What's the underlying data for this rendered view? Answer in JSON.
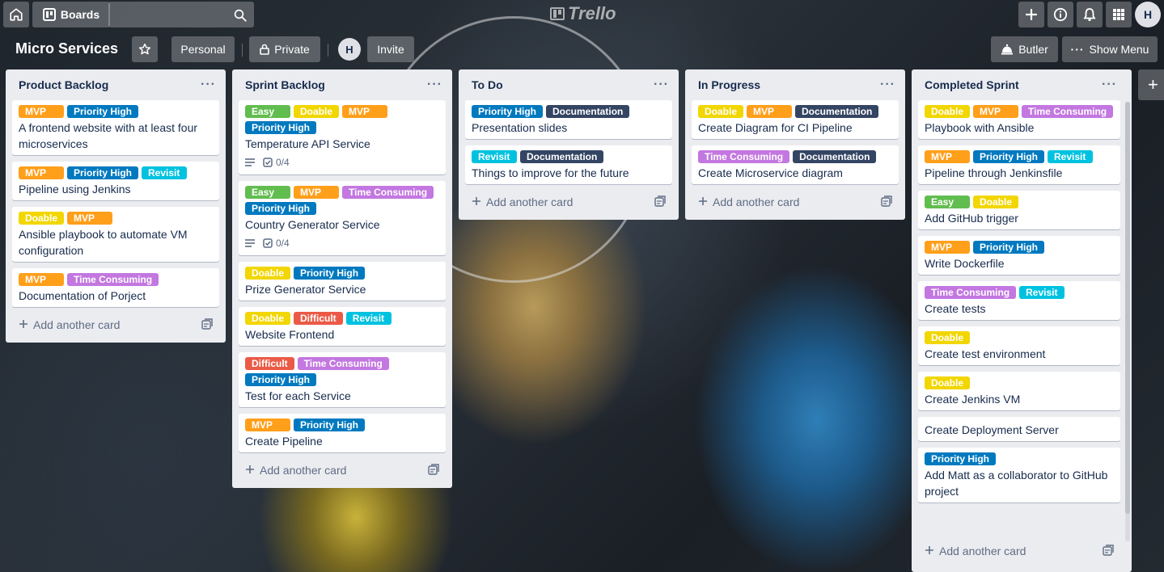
{
  "topbar": {
    "boards_label": "Boards",
    "logo_text": "Trello",
    "avatar_initial": "H"
  },
  "board": {
    "title": "Micro Services",
    "personal_label": "Personal",
    "private_label": "Private",
    "member_initial": "H",
    "invite_label": "Invite",
    "butler_label": "Butler",
    "show_menu_label": "Show Menu"
  },
  "label_colors": {
    "MVP": "#ff9f1a",
    "Priority High": "#0079bf",
    "Revisit": "#00c2e0",
    "Doable": "#f2d600",
    "Time Consuming": "#c377e0",
    "Easy": "#61bd4f",
    "Documentation": "#344563",
    "Difficult": "#eb5a46"
  },
  "add_card_label": "Add another card",
  "lists": [
    {
      "title": "Product Backlog",
      "cards": [
        {
          "labels": [
            "MVP",
            "Priority High"
          ],
          "title": "A frontend website with at least four microservices"
        },
        {
          "labels": [
            "MVP",
            "Priority High",
            "Revisit"
          ],
          "title": "Pipeline using Jenkins"
        },
        {
          "labels": [
            "Doable",
            "MVP"
          ],
          "title": "Ansible playbook to automate VM configuration"
        },
        {
          "labels": [
            "MVP",
            "Time Consuming"
          ],
          "title": "Documentation of Porject"
        }
      ]
    },
    {
      "title": "Sprint Backlog",
      "cards": [
        {
          "labels": [
            "Easy",
            "Doable",
            "MVP",
            "Priority High"
          ],
          "title": "Temperature API Service",
          "checklist": "0/4"
        },
        {
          "labels": [
            "Easy",
            "MVP",
            "Time Consuming",
            "Priority High"
          ],
          "title": "Country Generator Service",
          "checklist": "0/4"
        },
        {
          "labels": [
            "Doable",
            "Priority High"
          ],
          "title": "Prize Generator Service"
        },
        {
          "labels": [
            "Doable",
            "Difficult",
            "Revisit"
          ],
          "title": "Website Frontend"
        },
        {
          "labels": [
            "Difficult",
            "Time Consuming",
            "Priority High"
          ],
          "title": "Test for each Service"
        },
        {
          "labels": [
            "MVP",
            "Priority High"
          ],
          "title": "Create Pipeline"
        }
      ]
    },
    {
      "title": "To Do",
      "cards": [
        {
          "labels": [
            "Priority High",
            "Documentation"
          ],
          "title": "Presentation slides"
        },
        {
          "labels": [
            "Revisit",
            "Documentation"
          ],
          "title": "Things to improve for the future"
        }
      ]
    },
    {
      "title": "In Progress",
      "cards": [
        {
          "labels": [
            "Doable",
            "MVP",
            "Documentation"
          ],
          "title": "Create Diagram for CI Pipeline"
        },
        {
          "labels": [
            "Time Consuming",
            "Documentation"
          ],
          "title": "Create Microservice diagram"
        }
      ]
    },
    {
      "title": "Completed Sprint",
      "cards": [
        {
          "labels": [
            "Doable",
            "MVP",
            "Time Consuming"
          ],
          "title": "Playbook with Ansible"
        },
        {
          "labels": [
            "MVP",
            "Priority High",
            "Revisit"
          ],
          "title": "Pipeline through Jenkinsfile"
        },
        {
          "labels": [
            "Easy",
            "Doable"
          ],
          "title": "Add GitHub trigger"
        },
        {
          "labels": [
            "MVP",
            "Priority High"
          ],
          "title": "Write Dockerfile"
        },
        {
          "labels": [
            "Time Consuming",
            "Revisit"
          ],
          "title": "Create tests"
        },
        {
          "labels": [
            "Doable"
          ],
          "title": "Create test environment"
        },
        {
          "labels": [
            "Doable"
          ],
          "title": "Create Jenkins VM"
        },
        {
          "labels": [],
          "title": "Create Deployment Server"
        },
        {
          "labels": [
            "Priority High"
          ],
          "title": "Add Matt as a collaborator to GitHub project"
        }
      ]
    }
  ]
}
